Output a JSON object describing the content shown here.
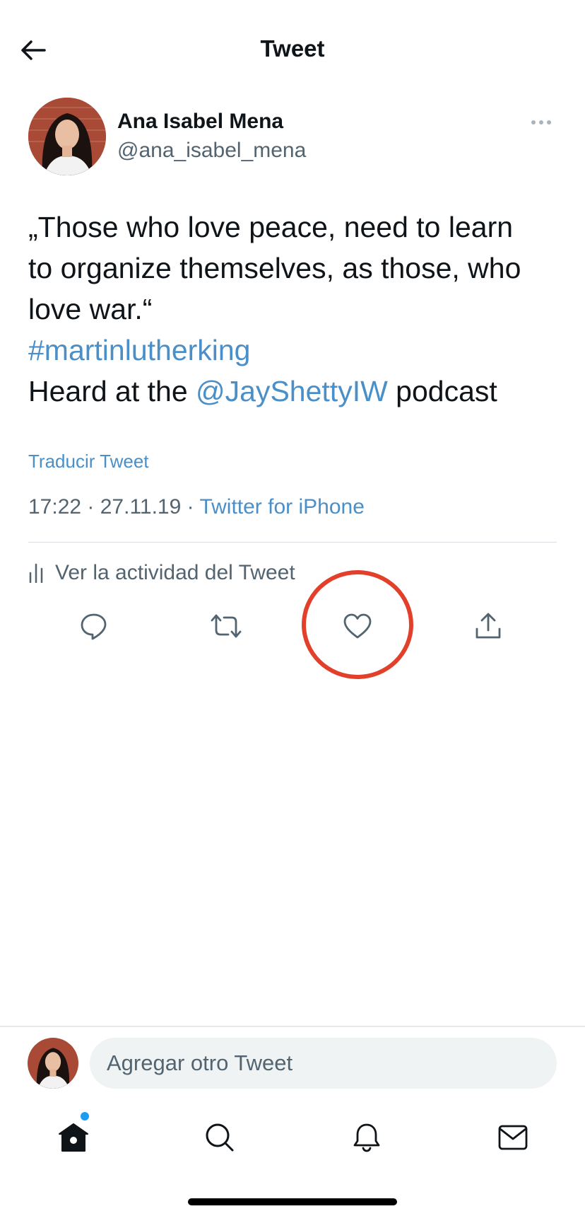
{
  "header": {
    "title": "Tweet",
    "back_icon": "arrow-left-icon"
  },
  "author": {
    "name": "Ana Isabel Mena",
    "handle": "@ana_isabel_mena",
    "more_icon": "more-horizontal-icon"
  },
  "tweet": {
    "line1": "„Those who love peace, need to learn",
    "line2": "to organize themselves, as those, who",
    "line3": "love war.“",
    "hashtag": "#martinlutherking",
    "line5_prefix": "Heard at the ",
    "mention": "@JayShettyIW",
    "line5_suffix": " podcast"
  },
  "translate_label": "Traducir Tweet",
  "meta": {
    "time": "17:22",
    "date": "27.11.19",
    "separator": " · ",
    "source": "Twitter for iPhone"
  },
  "activity_label": "Ver la actividad del Tweet",
  "actions": {
    "reply_icon": "reply-icon",
    "retweet_icon": "retweet-icon",
    "like_icon": "heart-icon",
    "share_icon": "share-icon"
  },
  "reply_bar": {
    "placeholder": "Agregar otro Tweet"
  },
  "tab_bar": {
    "items": [
      "home-icon",
      "search-icon",
      "notifications-icon",
      "messages-icon"
    ]
  },
  "colors": {
    "link": "#4a8fc7",
    "highlight": "#e2402a",
    "secondary_text": "#536471",
    "notification_dot": "#1d9bf0"
  }
}
